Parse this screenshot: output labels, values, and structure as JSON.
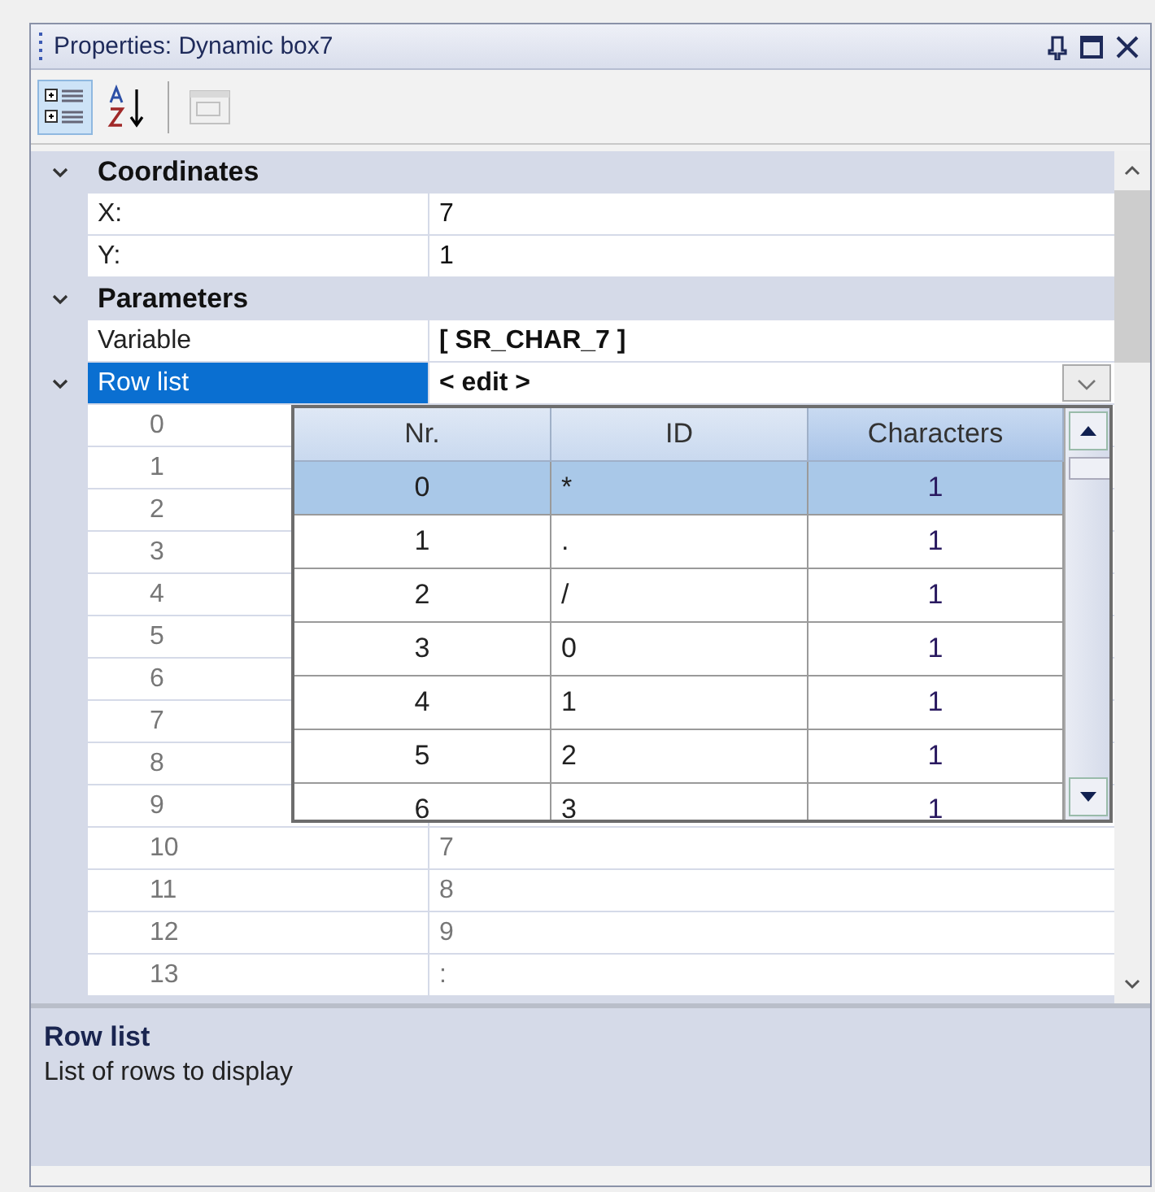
{
  "window": {
    "title": "Properties: Dynamic box7"
  },
  "toolbar": [
    {
      "kind": "categorized",
      "selected": true,
      "disabled": false
    },
    {
      "kind": "alphabetical",
      "selected": false,
      "disabled": false
    },
    {
      "kind": "pages",
      "selected": false,
      "disabled": true
    }
  ],
  "categories": [
    {
      "name": "Coordinates",
      "expanded": true,
      "properties": [
        {
          "name": "X:",
          "value": "7",
          "selected": false,
          "bold": false
        },
        {
          "name": "Y:",
          "value": "1",
          "selected": false,
          "bold": false
        }
      ]
    },
    {
      "name": "Parameters",
      "expanded": true,
      "properties": [
        {
          "name": "Variable",
          "value": "[ SR_CHAR_7 ]",
          "selected": false,
          "bold": true
        },
        {
          "name": "Row list",
          "value": "< edit >",
          "selected": true,
          "bold": true,
          "expanded": true,
          "children": [
            {
              "name": "0"
            },
            {
              "name": "1"
            },
            {
              "name": "2"
            },
            {
              "name": "3"
            },
            {
              "name": "4"
            },
            {
              "name": "5"
            },
            {
              "name": "6"
            },
            {
              "name": "7"
            },
            {
              "name": "8"
            },
            {
              "name": "9"
            },
            {
              "name": "10",
              "value": "7"
            },
            {
              "name": "11",
              "value": "8"
            },
            {
              "name": "12",
              "value": "9"
            },
            {
              "name": "13",
              "value": ":"
            }
          ]
        }
      ]
    }
  ],
  "dropdown": {
    "columns": [
      "Nr.",
      "ID",
      "Characters"
    ],
    "rows": [
      {
        "nr": "0",
        "id": "*",
        "characters": "1",
        "selected": true
      },
      {
        "nr": "1",
        "id": ".",
        "characters": "1",
        "selected": false
      },
      {
        "nr": "2",
        "id": "/",
        "characters": "1",
        "selected": false
      },
      {
        "nr": "3",
        "id": "0",
        "characters": "1",
        "selected": false
      },
      {
        "nr": "4",
        "id": "1",
        "characters": "1",
        "selected": false
      },
      {
        "nr": "5",
        "id": "2",
        "characters": "1",
        "selected": false
      },
      {
        "nr": "6",
        "id": "3",
        "characters": "1",
        "selected": false
      }
    ]
  },
  "description": {
    "title": "Row list",
    "text": "List of rows to display"
  }
}
